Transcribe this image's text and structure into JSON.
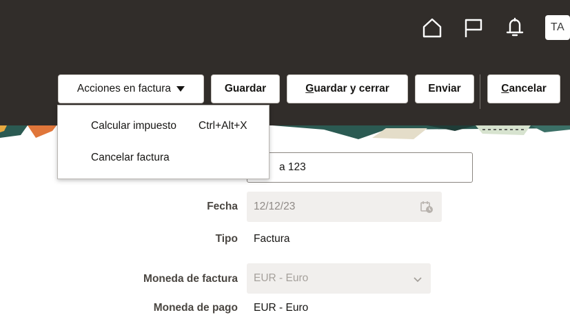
{
  "header": {
    "avatar_initials": "TA",
    "icons": [
      "home-icon",
      "flag-icon",
      "bell-icon"
    ],
    "background_color": "#312d2a"
  },
  "toolbar": {
    "actions_label": "Acciones en factura",
    "save_label": "Guardar",
    "save_close_mnemonic": "G",
    "save_close_rest": "uardar y cerrar",
    "submit_label": "Enviar",
    "cancel_mnemonic": "C",
    "cancel_rest": "ancelar"
  },
  "actions_menu": {
    "items": [
      {
        "label": "Calcular impuesto",
        "shortcut": "Ctrl+Alt+X"
      },
      {
        "label": "Cancelar factura",
        "shortcut": ""
      }
    ]
  },
  "form": {
    "number_value": "a 123",
    "date_label": "Fecha",
    "date_value": "12/12/23",
    "type_label": "Tipo",
    "type_value": "Factura",
    "invoice_currency_label": "Moneda de factura",
    "invoice_currency_value": "EUR - Euro",
    "payment_currency_label": "Moneda de pago",
    "payment_currency_value": "EUR - Euro"
  }
}
